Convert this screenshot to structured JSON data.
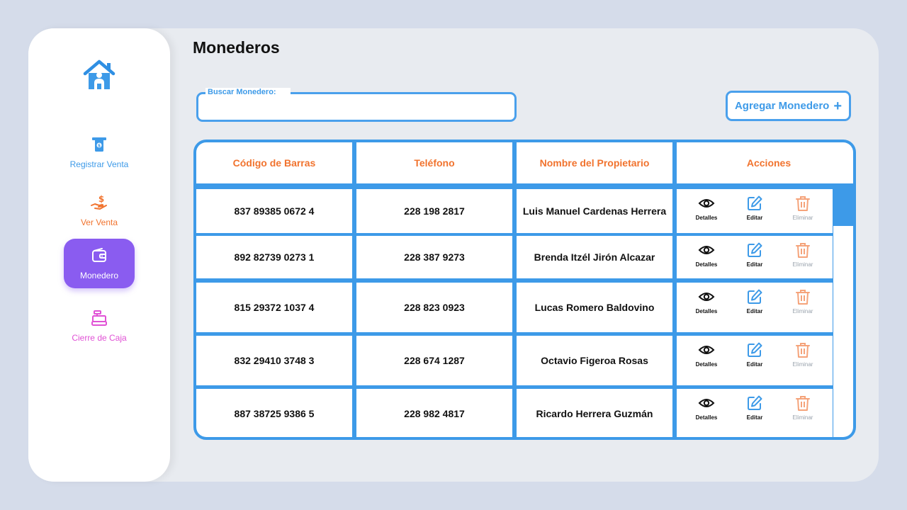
{
  "app": {
    "title": "Monederos"
  },
  "sidebar": {
    "items": [
      {
        "label": "Registrar Venta",
        "icon": "cash-register-icon"
      },
      {
        "label": "Ver Venta",
        "icon": "money-hand-icon"
      },
      {
        "label": "Monedero",
        "icon": "wallet-icon",
        "active": true
      },
      {
        "label": "Cierre de Caja",
        "icon": "till-icon"
      }
    ]
  },
  "search": {
    "label": "Buscar Monedero:",
    "value": "",
    "placeholder": ""
  },
  "add_button": {
    "label": "Agregar Monedero",
    "icon": "plus-icon"
  },
  "table": {
    "headers": [
      "Código de Barras",
      "Teléfono",
      "Nombre del Propietario",
      "Acciones"
    ],
    "rows": [
      {
        "barcode": "837 89385 0672 4",
        "phone": "228 198 2817",
        "owner": "Luis Manuel Cardenas Herrera"
      },
      {
        "barcode": "892 82739 0273 1",
        "phone": "228 387 9273",
        "owner": "Brenda Itzél Jirón Alcazar"
      },
      {
        "barcode": "815 29372 1037 4",
        "phone": "228 823 0923",
        "owner": "Lucas Romero Baldovino"
      },
      {
        "barcode": "832 29410 3748 3",
        "phone": "228 674 1287",
        "owner": "Octavio Figeroa Rosas"
      },
      {
        "barcode": "887 38725 9386 5",
        "phone": "228 982 4817",
        "owner": "Ricardo Herrera Guzmán"
      }
    ],
    "actions": {
      "details": "Detalles",
      "edit": "Editar",
      "delete": "Eliminar"
    }
  },
  "colors": {
    "accent_blue": "#3d9ae8",
    "header_orange": "#f1732e",
    "active_purple": "#8a5cf0",
    "pink": "#e051d5",
    "delete_orange": "#f5a37a"
  }
}
